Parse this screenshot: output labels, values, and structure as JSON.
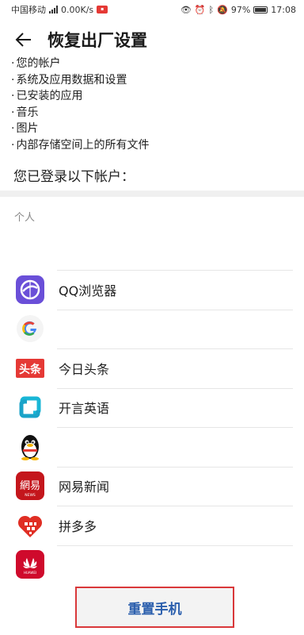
{
  "status_bar": {
    "carrier": "中国移动",
    "net_speed": "0.00K/s",
    "battery": "97%",
    "time": "17:08"
  },
  "header": {
    "title": "恢复出厂设置"
  },
  "erase_list": [
    "您的帐户",
    "系统及应用数据和设置",
    "已安装的应用",
    "音乐",
    "图片",
    "内部存储空间上的所有文件"
  ],
  "accounts_heading": "您已登录以下帐户：",
  "section_label": "个人",
  "apps": [
    {
      "name": "QQ浏览器",
      "icon": "qq-browser-icon"
    },
    {
      "name": "",
      "icon": "google-icon"
    },
    {
      "name": "今日头条",
      "icon": "toutiao-icon"
    },
    {
      "name": "开言英语",
      "icon": "kaiyan-icon"
    },
    {
      "name": "",
      "icon": "qq-penguin-icon"
    },
    {
      "name": "网易新闻",
      "icon": "netease-news-icon"
    },
    {
      "name": "拼多多",
      "icon": "pinduoduo-icon"
    },
    {
      "name": "",
      "icon": "huawei-icon"
    }
  ],
  "reset_button": "重置手机",
  "colors": {
    "accent": "#2b5fad",
    "highlight_border": "#d9383a"
  }
}
